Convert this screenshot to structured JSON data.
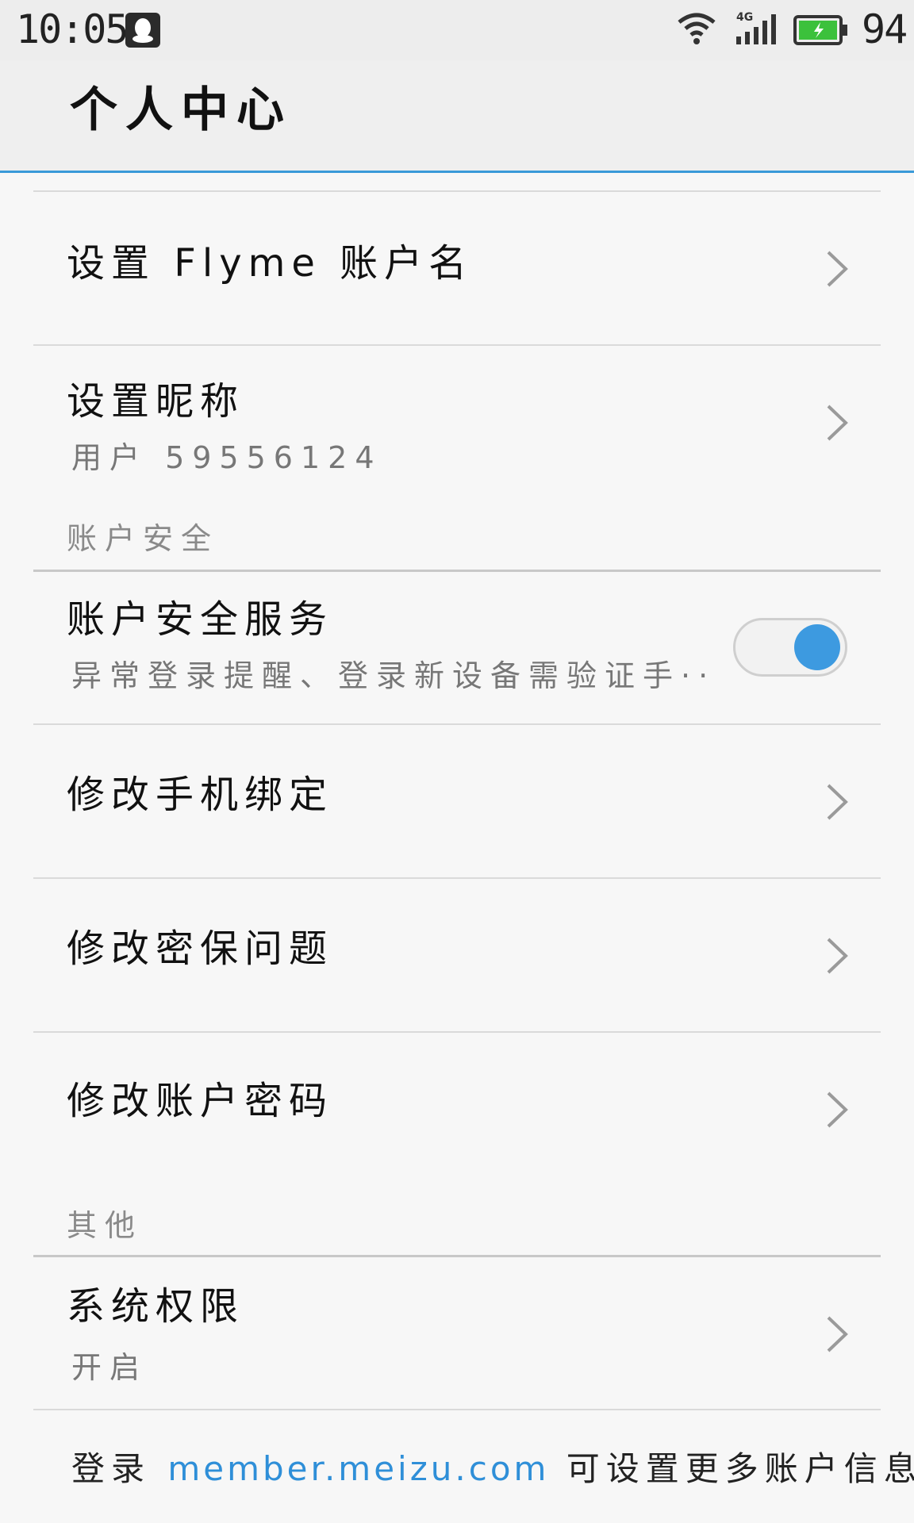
{
  "status_bar": {
    "time": "10:05",
    "battery_level": "94",
    "network": "4G",
    "icons": [
      "qq-icon",
      "wifi-icon",
      "signal-icon",
      "battery-icon"
    ]
  },
  "header": {
    "title": "个人中心"
  },
  "rows": {
    "account_name": {
      "title": "设置 Flyme 账户名"
    },
    "nickname": {
      "title": "设置昵称",
      "subtitle": "用户 59556124"
    },
    "security_section": "账户安全",
    "security_service": {
      "title": "账户安全服务",
      "subtitle": "异常登录提醒、登录新设备需验证手··",
      "enabled": true
    },
    "change_phone": {
      "title": "修改手机绑定"
    },
    "change_security_question": {
      "title": "修改密保问题"
    },
    "change_password": {
      "title": "修改账户密码"
    },
    "other_section": "其他",
    "system_permission": {
      "title": "系统权限",
      "subtitle": "开启"
    }
  },
  "footer": {
    "prefix": "登录 ",
    "link": "member.meizu.com",
    "suffix": " 可设置更多账户信息"
  },
  "colors": {
    "accent": "#3d9ae0",
    "header_line": "#3a9ad9",
    "link": "#2f8fd8"
  }
}
